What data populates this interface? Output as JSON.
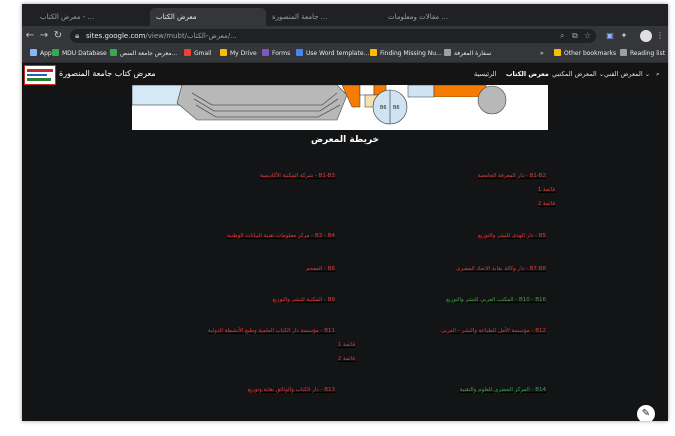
{
  "browser": {
    "tabs": [
      {
        "label": "معرض الكتاب - ... ",
        "active": false
      },
      {
        "label": "معرض الكتاب",
        "active": true
      },
      {
        "label": "جامعة المنصورة ...",
        "active": false
      },
      {
        "label": "مقالات ومعلومات ...",
        "active": false
      }
    ],
    "url_host": "sites.google.com",
    "url_path": "/view/mubt/معرض-الكتاب/..."
  },
  "bookmarks": [
    {
      "label": "Apps",
      "color": "#8ab4f8"
    },
    {
      "label": "MDU Database",
      "color": "#34a853"
    },
    {
      "label": "معرض جامعة المنص...",
      "color": "#34a853"
    },
    {
      "label": "Gmail",
      "color": "#ea4335"
    },
    {
      "label": "My Drive",
      "color": "#fbbc04"
    },
    {
      "label": "Forms",
      "color": "#7e57c2"
    },
    {
      "label": "Use Word template...",
      "color": "#4285f4"
    },
    {
      "label": "Finding Missing Nu...",
      "color": "#fbbc04"
    },
    {
      "label": "سفارة المعرفة",
      "color": "#9aa0a6"
    }
  ],
  "bookmarks_more": "»",
  "bookmarks_other": "Other bookmarks",
  "bookmarks_reading": "Reading list",
  "site": {
    "title": "معرض كتاب جامعة المنصورة",
    "nav": [
      {
        "label": "الرئيسية",
        "bold": false
      },
      {
        "label": "معرض الكتاب",
        "bold": true
      },
      {
        "label": "المعرض المكتبي",
        "bold": false,
        "dropdown": true
      },
      {
        "label": "المعرض الفني",
        "bold": false,
        "dropdown": true
      }
    ]
  },
  "map_title": "خريطة المعرض",
  "links_right": [
    {
      "text": "B1-B2 - دار المعرفة الجامعية",
      "color": "red"
    },
    {
      "text": "قائمة 1",
      "color": "red"
    },
    {
      "text": "قائمة 2",
      "color": "red"
    },
    {
      "text": "B5 - دار الهدى للنشر والتوزيع",
      "color": "red"
    },
    {
      "text": "B7-B8 - دار وكالة نقابة الاتحاد المصري",
      "color": "red"
    },
    {
      "text": "B10 - B16 - المكتب العربي للنشر والتوزيع",
      "color": "green"
    },
    {
      "text": "B12 - مؤسسة الأمل للطباعة والنشر - العربي",
      "color": "red"
    },
    {
      "text": "B14 - المركز الحضري للعلوم والتقنية",
      "color": "green"
    }
  ],
  "links_left": [
    {
      "text": "B1-B3 - شركة المكتبة الأكاديمية",
      "color": "red"
    },
    {
      "text": "B3 - B4 - مركز معلومات تقنية البيانات الوطنية",
      "color": "red"
    },
    {
      "text": "B6 - المعجم",
      "color": "red"
    },
    {
      "text": "B9 - المكتبة للنشر والتوزيع",
      "color": "red"
    },
    {
      "text": "B11 - مؤسسة دار الكتاب العلمية وطبع الأنشطة الدولية",
      "color": "red"
    },
    {
      "text": "قائمة 1",
      "color": "red"
    },
    {
      "text": "قائمة 2",
      "color": "red"
    },
    {
      "text": "B13 - دار الكتاب والوثائق نقابة وتوزيع",
      "color": "red"
    }
  ],
  "colors": {
    "red": "#e53935",
    "green": "#43a047",
    "accent": "#f57c00"
  }
}
